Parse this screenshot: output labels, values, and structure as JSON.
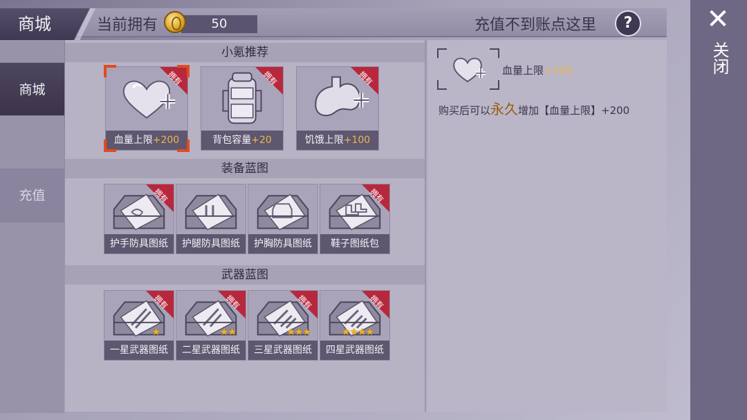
{
  "header": {
    "title": "商城",
    "owned_label": "当前拥有",
    "coin_icon": "gold-coin-icon",
    "coin_value": "50",
    "recharge_text": "充值不到账点这里",
    "help_label": "?"
  },
  "sidebar": {
    "items": [
      {
        "label": "商城",
        "active": true
      },
      {
        "label": "充值",
        "active": false
      }
    ]
  },
  "close": {
    "symbol": "✕",
    "label": "关闭"
  },
  "sections": [
    {
      "title": "小氪推荐",
      "items": [
        {
          "name": "血量上限",
          "bonus": "+200",
          "owned": true,
          "badge": "拥有",
          "icon": "heart-plus-icon",
          "selected": true
        },
        {
          "name": "背包容量",
          "bonus": "+20",
          "owned": true,
          "badge": "拥有",
          "icon": "backpack-icon",
          "selected": false
        },
        {
          "name": "饥饿上限",
          "bonus": "+100",
          "owned": true,
          "badge": "拥有",
          "icon": "stomach-plus-icon",
          "selected": false
        }
      ]
    },
    {
      "title": "装备蓝图",
      "items": [
        {
          "name": "护手防具图纸",
          "owned": true,
          "badge": "拥有",
          "icon": "blueprint-toolbox-icon"
        },
        {
          "name": "护腿防具图纸",
          "owned": false,
          "icon": "blueprint-toolbox-icon"
        },
        {
          "name": "护胸防具图纸",
          "owned": false,
          "icon": "blueprint-toolbox-icon"
        },
        {
          "name": "鞋子图纸包",
          "owned": true,
          "badge": "拥有",
          "icon": "blueprint-toolbox-icon"
        }
      ]
    },
    {
      "title": "武器蓝图",
      "items": [
        {
          "name": "一星武器图纸",
          "owned": true,
          "badge": "拥有",
          "stars": 1,
          "icon": "weapon-blueprint-icon"
        },
        {
          "name": "二星武器图纸",
          "owned": true,
          "badge": "拥有",
          "stars": 2,
          "icon": "weapon-blueprint-icon"
        },
        {
          "name": "三星武器图纸",
          "owned": true,
          "badge": "拥有",
          "stars": 3,
          "icon": "weapon-blueprint-icon"
        },
        {
          "name": "四星武器图纸",
          "owned": true,
          "badge": "拥有",
          "stars": 4,
          "icon": "weapon-blueprint-icon"
        }
      ]
    }
  ],
  "detail": {
    "icon": "heart-plus-icon",
    "name": "血量上限",
    "bonus": "+200",
    "desc_pre": "购买后可以",
    "desc_emph": "永久",
    "desc_post": "增加【血量上限】+200"
  },
  "colors": {
    "accent_selected": "#e24a1e",
    "ribbon": "#b8283d",
    "bonus": "#e9b84a",
    "emph": "#9a5a10"
  }
}
